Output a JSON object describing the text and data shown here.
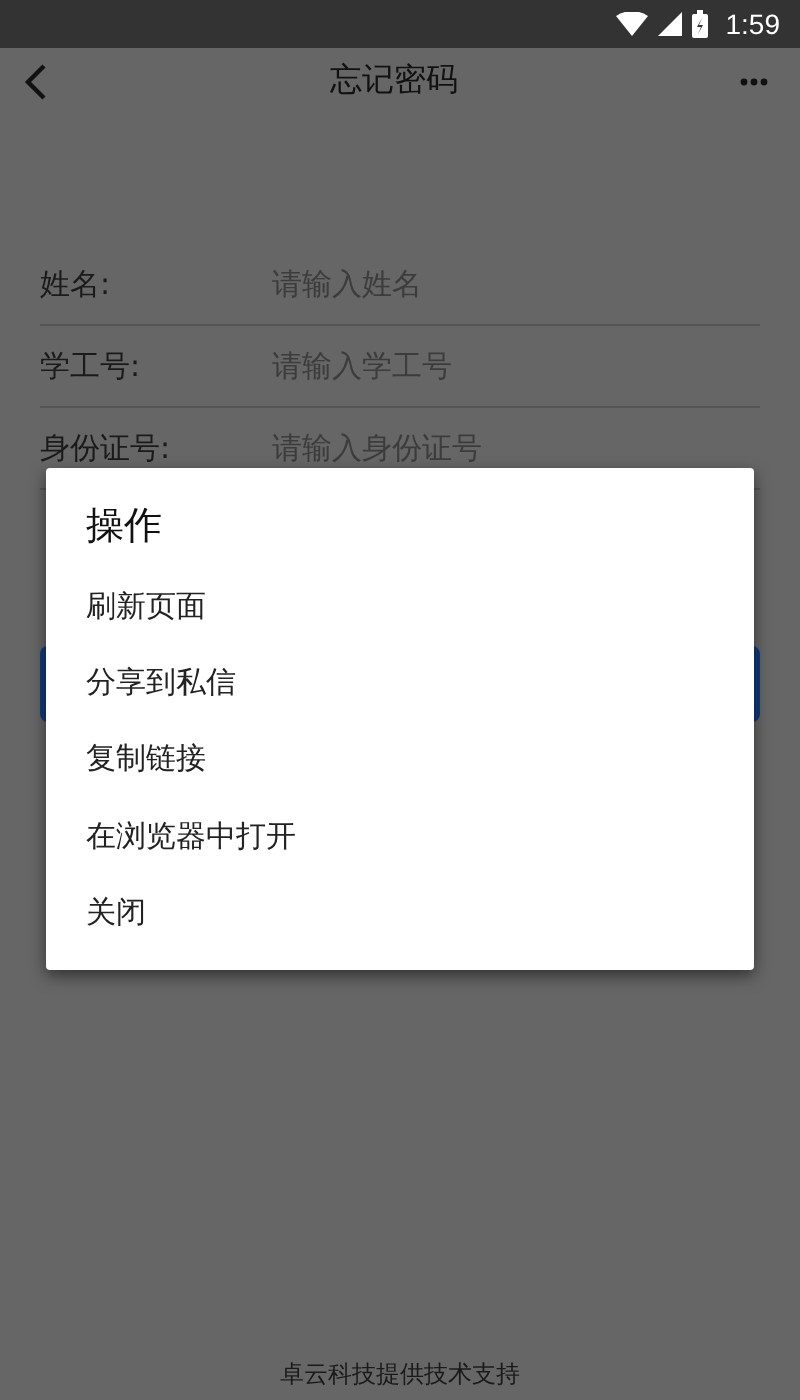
{
  "status_bar": {
    "time": "1:59"
  },
  "app_bar": {
    "title": "忘记密码"
  },
  "form": {
    "fields": [
      {
        "label": "姓名:",
        "placeholder": "请输入姓名"
      },
      {
        "label": "学工号:",
        "placeholder": "请输入学工号"
      },
      {
        "label": "身份证号:",
        "placeholder": "请输入身份证号"
      }
    ]
  },
  "dialog": {
    "title": "操作",
    "items": [
      "刷新页面",
      "分享到私信",
      "复制链接",
      "在浏览器中打开",
      "关闭"
    ]
  },
  "footer": "卓云科技提供技术支持"
}
